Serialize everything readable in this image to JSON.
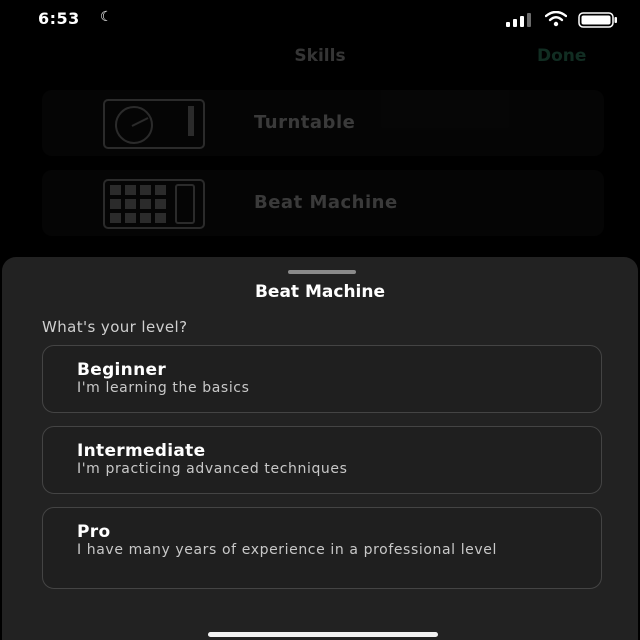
{
  "status_bar": {
    "time": "6:53"
  },
  "background": {
    "title": "Skills",
    "done_label": "Done",
    "items": [
      {
        "label": "Turntable",
        "icon": "turntable-icon"
      },
      {
        "label": "Beat Machine",
        "icon": "drum-pad-icon"
      }
    ]
  },
  "sheet": {
    "title": "Beat Machine",
    "question": "What's your level?",
    "options": [
      {
        "title": "Beginner",
        "description": "I'm learning the basics"
      },
      {
        "title": "Intermediate",
        "description": "I'm practicing advanced techniques"
      },
      {
        "title": "Pro",
        "description": "I have many years of experience in a professional level"
      }
    ]
  },
  "colors": {
    "background": "#000000",
    "sheet": "#222222",
    "accent_done": "#3ea17a",
    "option_border": "#444444"
  }
}
